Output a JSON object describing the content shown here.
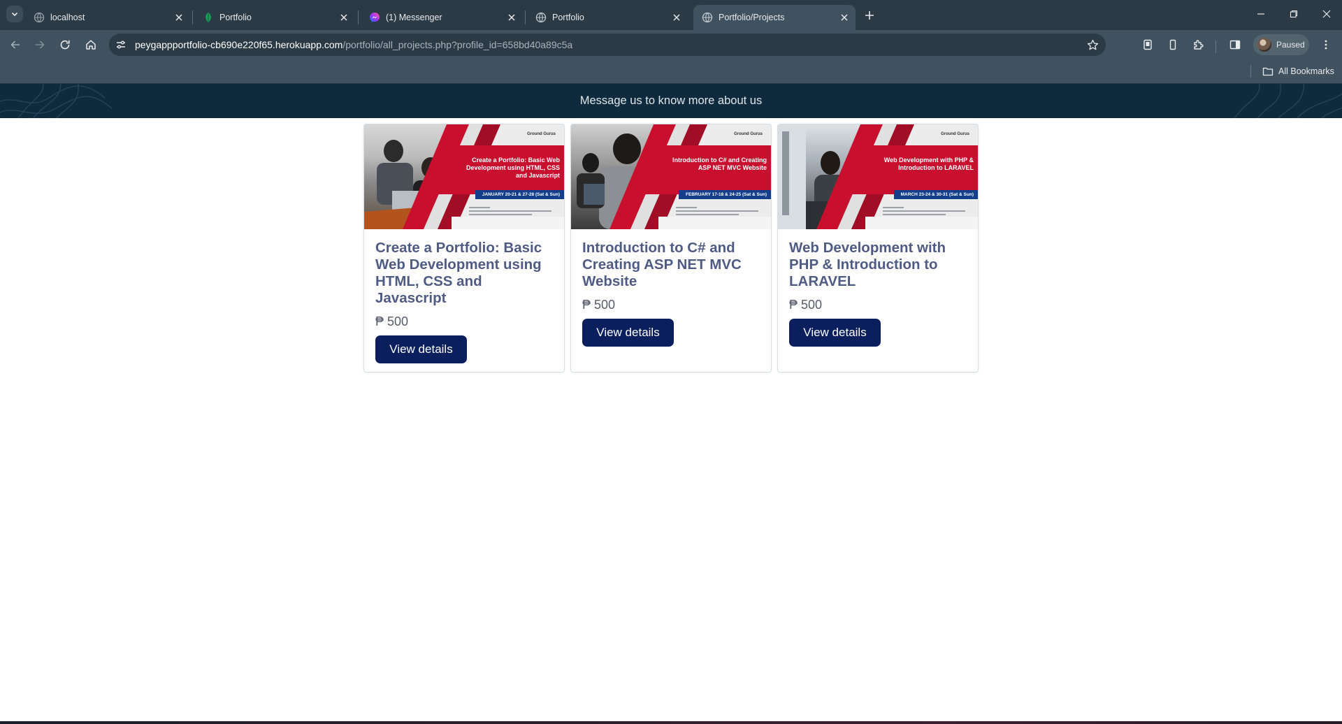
{
  "browser": {
    "tabs": [
      {
        "title": "localhost",
        "favicon": "globe-icon",
        "active": false
      },
      {
        "title": "Portfolio",
        "favicon": "leaf-icon",
        "active": false
      },
      {
        "title": "(1) Messenger",
        "favicon": "messenger-icon",
        "active": false
      },
      {
        "title": "Portfolio",
        "favicon": "globe-icon",
        "active": false
      },
      {
        "title": "Portfolio/Projects",
        "favicon": "globe-icon",
        "active": true
      }
    ],
    "url_host": "peygappportfolio-cb690e220f65.herokuapp.com",
    "url_path": "/portfolio/all_projects.php?profile_id=658bd40a89c5a",
    "profile_label": "Paused",
    "bookmarks_label": "All Bookmarks"
  },
  "page": {
    "banner_text": "Message us to know more about us",
    "projects": [
      {
        "title": "Create a Portfolio: Basic Web Development using HTML, CSS and Javascript",
        "price": "₱ 500",
        "button_label": "View details",
        "thumbnail": {
          "brand": "Ground Gurus",
          "headline": "Create a Portfolio: Basic Web Development using HTML, CSS and Javascript",
          "dates": "JANUARY 20-21 & 27-28 (Sat & Sun)"
        }
      },
      {
        "title": "Introduction to C# and Creating ASP NET MVC Website",
        "price": "₱ 500",
        "button_label": "View details",
        "thumbnail": {
          "brand": "Ground Gurus",
          "headline": "Introduction to C# and Creating ASP NET MVC Website",
          "dates": "FEBRUARY 17-18 & 24-25 (Sat & Sun)"
        }
      },
      {
        "title": "Web Development with PHP & Introduction to LARAVEL",
        "price": "₱ 500",
        "button_label": "View details",
        "thumbnail": {
          "brand": "Ground Gurus",
          "headline": "Web Development with PHP & Introduction to LARAVEL",
          "dates": "MARCH 23-24 & 30-31 (Sat & Sun)"
        }
      }
    ]
  },
  "colors": {
    "tabstrip": "#2b3a45",
    "toolbar": "#40525f",
    "banner": "#0f2a3c",
    "card_title": "#4f5b82",
    "button": "#0b1f5e",
    "thumb_red": "#c8102e"
  }
}
